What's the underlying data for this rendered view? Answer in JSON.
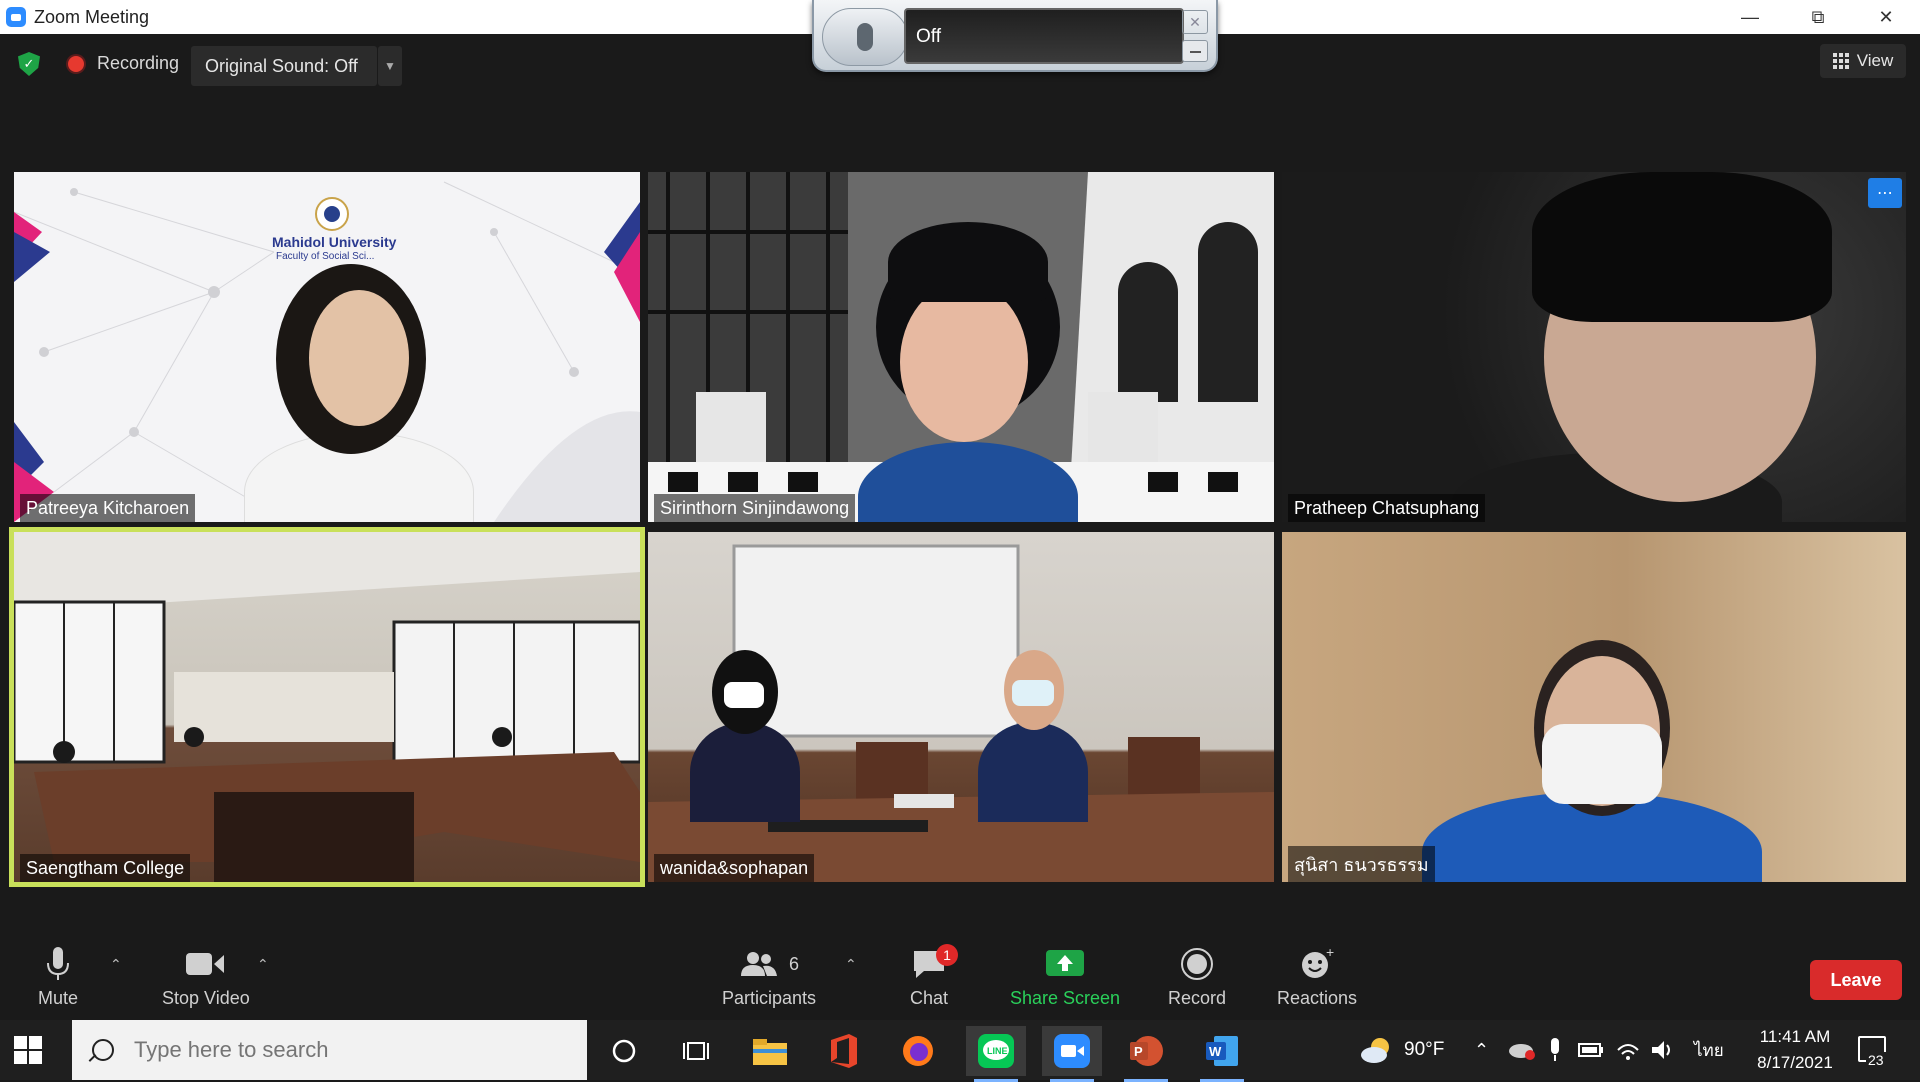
{
  "window": {
    "title": "Zoom Meeting"
  },
  "mic_widget": {
    "state": "Off"
  },
  "top_bar": {
    "recording_label": "Recording",
    "original_sound": "Original Sound: Off",
    "view_label": "View"
  },
  "participants_tiles": [
    {
      "name": "Patreeya Kitcharoen"
    },
    {
      "name": "Sirinthorn Sinjindawong"
    },
    {
      "name": "Pratheep Chatsuphang"
    },
    {
      "name": "Saengtham College"
    },
    {
      "name": "wanida&sophapan"
    },
    {
      "name": "สุนิสา ธนวรธรรม"
    }
  ],
  "tile1_logo": {
    "line1": "Mahidol University",
    "line2": "Faculty of Social Sci..."
  },
  "toolbar": {
    "mute": "Mute",
    "stop_video": "Stop Video",
    "participants": "Participants",
    "participants_count": "6",
    "chat": "Chat",
    "chat_badge": "1",
    "share_screen": "Share Screen",
    "record": "Record",
    "reactions": "Reactions",
    "leave": "Leave"
  },
  "taskbar": {
    "search_placeholder": "Type here to search",
    "temperature": "90°F",
    "language": "ไทย",
    "time": "11:41 AM",
    "date": "8/17/2021",
    "notification_count": "23"
  },
  "colors": {
    "speaker_border": "#c9e05a",
    "leave_red": "#d92b2b",
    "share_green": "#1ea446",
    "zoom_blue": "#2d8cff"
  }
}
